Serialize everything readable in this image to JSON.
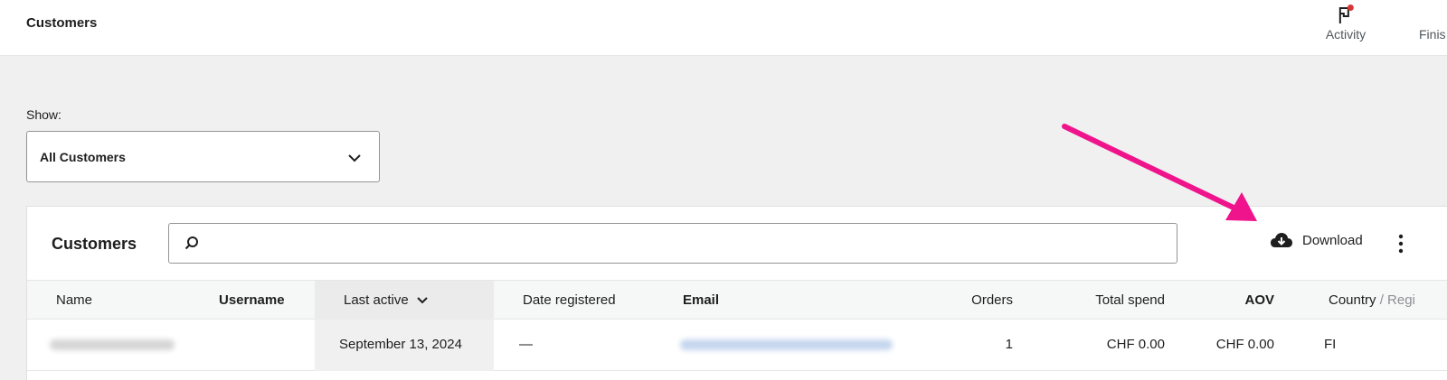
{
  "header": {
    "title": "Customers",
    "activity_label": "Activity",
    "finish_label": "Finis"
  },
  "filter": {
    "show_label": "Show:",
    "selected": "All Customers"
  },
  "panel": {
    "title": "Customers",
    "search_placeholder": "",
    "download_label": "Download"
  },
  "table": {
    "columns": {
      "name": "Name",
      "username": "Username",
      "last_active": "Last active",
      "date_registered": "Date registered",
      "email": "Email",
      "orders": "Orders",
      "total_spend": "Total spend",
      "aov": "AOV",
      "country": "Country",
      "country_suffix": "/ Regi"
    },
    "rows": [
      {
        "last_active": "September 13, 2024",
        "date_registered": "—",
        "orders": "1",
        "total_spend": "CHF 0.00",
        "aov": "CHF 0.00",
        "country": "FI"
      }
    ]
  },
  "colors": {
    "annotation_arrow": "#f0148c",
    "notification_dot": "#d63638"
  }
}
